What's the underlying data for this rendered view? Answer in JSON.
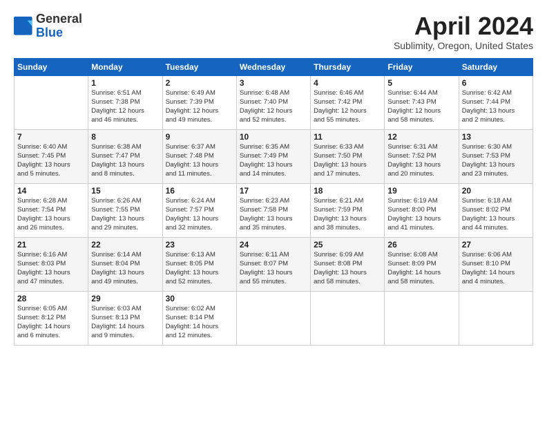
{
  "header": {
    "logo_general": "General",
    "logo_blue": "Blue",
    "month_title": "April 2024",
    "subtitle": "Sublimity, Oregon, United States"
  },
  "weekdays": [
    "Sunday",
    "Monday",
    "Tuesday",
    "Wednesday",
    "Thursday",
    "Friday",
    "Saturday"
  ],
  "weeks": [
    [
      {
        "day": "",
        "info": ""
      },
      {
        "day": "1",
        "info": "Sunrise: 6:51 AM\nSunset: 7:38 PM\nDaylight: 12 hours\nand 46 minutes."
      },
      {
        "day": "2",
        "info": "Sunrise: 6:49 AM\nSunset: 7:39 PM\nDaylight: 12 hours\nand 49 minutes."
      },
      {
        "day": "3",
        "info": "Sunrise: 6:48 AM\nSunset: 7:40 PM\nDaylight: 12 hours\nand 52 minutes."
      },
      {
        "day": "4",
        "info": "Sunrise: 6:46 AM\nSunset: 7:42 PM\nDaylight: 12 hours\nand 55 minutes."
      },
      {
        "day": "5",
        "info": "Sunrise: 6:44 AM\nSunset: 7:43 PM\nDaylight: 12 hours\nand 58 minutes."
      },
      {
        "day": "6",
        "info": "Sunrise: 6:42 AM\nSunset: 7:44 PM\nDaylight: 13 hours\nand 2 minutes."
      }
    ],
    [
      {
        "day": "7",
        "info": "Sunrise: 6:40 AM\nSunset: 7:45 PM\nDaylight: 13 hours\nand 5 minutes."
      },
      {
        "day": "8",
        "info": "Sunrise: 6:38 AM\nSunset: 7:47 PM\nDaylight: 13 hours\nand 8 minutes."
      },
      {
        "day": "9",
        "info": "Sunrise: 6:37 AM\nSunset: 7:48 PM\nDaylight: 13 hours\nand 11 minutes."
      },
      {
        "day": "10",
        "info": "Sunrise: 6:35 AM\nSunset: 7:49 PM\nDaylight: 13 hours\nand 14 minutes."
      },
      {
        "day": "11",
        "info": "Sunrise: 6:33 AM\nSunset: 7:50 PM\nDaylight: 13 hours\nand 17 minutes."
      },
      {
        "day": "12",
        "info": "Sunrise: 6:31 AM\nSunset: 7:52 PM\nDaylight: 13 hours\nand 20 minutes."
      },
      {
        "day": "13",
        "info": "Sunrise: 6:30 AM\nSunset: 7:53 PM\nDaylight: 13 hours\nand 23 minutes."
      }
    ],
    [
      {
        "day": "14",
        "info": "Sunrise: 6:28 AM\nSunset: 7:54 PM\nDaylight: 13 hours\nand 26 minutes."
      },
      {
        "day": "15",
        "info": "Sunrise: 6:26 AM\nSunset: 7:55 PM\nDaylight: 13 hours\nand 29 minutes."
      },
      {
        "day": "16",
        "info": "Sunrise: 6:24 AM\nSunset: 7:57 PM\nDaylight: 13 hours\nand 32 minutes."
      },
      {
        "day": "17",
        "info": "Sunrise: 6:23 AM\nSunset: 7:58 PM\nDaylight: 13 hours\nand 35 minutes."
      },
      {
        "day": "18",
        "info": "Sunrise: 6:21 AM\nSunset: 7:59 PM\nDaylight: 13 hours\nand 38 minutes."
      },
      {
        "day": "19",
        "info": "Sunrise: 6:19 AM\nSunset: 8:00 PM\nDaylight: 13 hours\nand 41 minutes."
      },
      {
        "day": "20",
        "info": "Sunrise: 6:18 AM\nSunset: 8:02 PM\nDaylight: 13 hours\nand 44 minutes."
      }
    ],
    [
      {
        "day": "21",
        "info": "Sunrise: 6:16 AM\nSunset: 8:03 PM\nDaylight: 13 hours\nand 47 minutes."
      },
      {
        "day": "22",
        "info": "Sunrise: 6:14 AM\nSunset: 8:04 PM\nDaylight: 13 hours\nand 49 minutes."
      },
      {
        "day": "23",
        "info": "Sunrise: 6:13 AM\nSunset: 8:05 PM\nDaylight: 13 hours\nand 52 minutes."
      },
      {
        "day": "24",
        "info": "Sunrise: 6:11 AM\nSunset: 8:07 PM\nDaylight: 13 hours\nand 55 minutes."
      },
      {
        "day": "25",
        "info": "Sunrise: 6:09 AM\nSunset: 8:08 PM\nDaylight: 13 hours\nand 58 minutes."
      },
      {
        "day": "26",
        "info": "Sunrise: 6:08 AM\nSunset: 8:09 PM\nDaylight: 14 hours\nand 58 minutes."
      },
      {
        "day": "27",
        "info": "Sunrise: 6:06 AM\nSunset: 8:10 PM\nDaylight: 14 hours\nand 4 minutes."
      }
    ],
    [
      {
        "day": "28",
        "info": "Sunrise: 6:05 AM\nSunset: 8:12 PM\nDaylight: 14 hours\nand 6 minutes."
      },
      {
        "day": "29",
        "info": "Sunrise: 6:03 AM\nSunset: 8:13 PM\nDaylight: 14 hours\nand 9 minutes."
      },
      {
        "day": "30",
        "info": "Sunrise: 6:02 AM\nSunset: 8:14 PM\nDaylight: 14 hours\nand 12 minutes."
      },
      {
        "day": "",
        "info": ""
      },
      {
        "day": "",
        "info": ""
      },
      {
        "day": "",
        "info": ""
      },
      {
        "day": "",
        "info": ""
      }
    ]
  ]
}
